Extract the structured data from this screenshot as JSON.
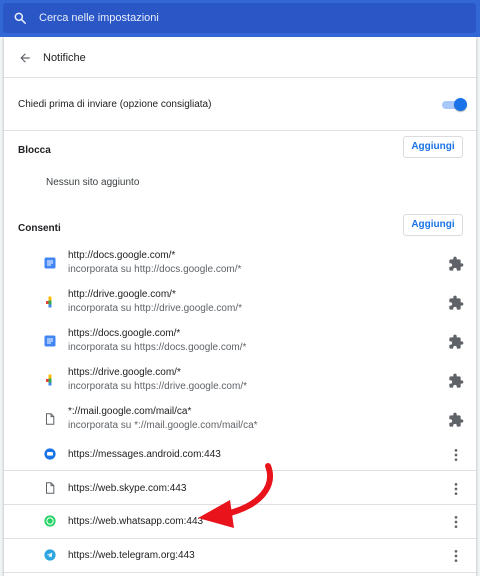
{
  "search": {
    "placeholder": "Cerca nelle impostazioni",
    "icon": "search-icon"
  },
  "header": {
    "title": "Notifiche",
    "back_icon": "back-arrow-icon"
  },
  "ask_before_sending": {
    "label": "Chiedi prima di inviare (opzione consigliata)",
    "enabled": true
  },
  "block": {
    "title": "Blocca",
    "add_label": "Aggiungi",
    "empty_text": "Nessun sito aggiunto"
  },
  "allow": {
    "title": "Consenti",
    "add_label": "Aggiungi",
    "sites": [
      {
        "url": "http://docs.google.com/*",
        "sub": "incorporata su http://docs.google.com/*",
        "icon": "google-docs-icon",
        "action_icon": "extension-icon"
      },
      {
        "url": "http://drive.google.com/*",
        "sub": "incorporata su http://drive.google.com/*",
        "icon": "google-drive-icon",
        "action_icon": "extension-icon"
      },
      {
        "url": "https://docs.google.com/*",
        "sub": "incorporata su https://docs.google.com/*",
        "icon": "google-docs-icon",
        "action_icon": "extension-icon"
      },
      {
        "url": "https://drive.google.com/*",
        "sub": "incorporata su https://drive.google.com/*",
        "icon": "google-drive-icon",
        "action_icon": "extension-icon"
      },
      {
        "url": "*://mail.google.com/mail/ca*",
        "sub": "incorporata su *://mail.google.com/mail/ca*",
        "icon": "page-icon",
        "action_icon": "extension-icon"
      },
      {
        "url": "https://messages.android.com:443",
        "icon": "messages-icon",
        "action_icon": "more-vert-icon"
      },
      {
        "url": "https://web.skype.com:443",
        "icon": "page-icon",
        "action_icon": "more-vert-icon"
      },
      {
        "url": "https://web.whatsapp.com:443",
        "icon": "whatsapp-icon",
        "action_icon": "more-vert-icon"
      },
      {
        "url": "https://web.telegram.org:443",
        "icon": "telegram-icon",
        "action_icon": "more-vert-icon"
      }
    ]
  },
  "colors": {
    "topbar": "#3367d6",
    "accent": "#1a73e8",
    "annotation_arrow": "#e8131b"
  }
}
